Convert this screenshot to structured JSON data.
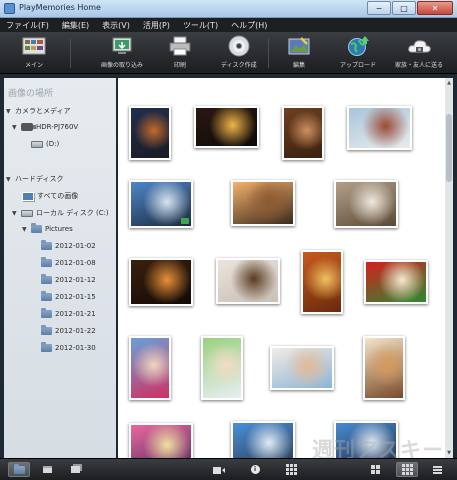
{
  "window": {
    "title": "PlayMemories Home",
    "minimize_glyph": "−",
    "maximize_glyph": "□",
    "close_glyph": "✕"
  },
  "menubar": [
    "ファイル(F)",
    "編集(E)",
    "表示(V)",
    "活用(P)",
    "ツール(T)",
    "ヘルプ(H)"
  ],
  "toolbar": {
    "main_label": "メイン",
    "import_label": "画像の取り込み",
    "print_label": "印刷",
    "disc_label": "ディスク作成",
    "edit_label": "編集",
    "upload_label": "アップロード",
    "share_label": "家族・友人に送る"
  },
  "sidebar": {
    "heading": "画像の場所",
    "camera_section": "カメラとメディア",
    "camera_device": "HDR-PJ760V",
    "camera_drive": "(D:)",
    "hdd_section": "ハードディスク",
    "all_images": "すべての画像",
    "local_disk": "ローカル ディスク (C:)",
    "pictures": "Pictures",
    "folders": [
      "2012-01-02",
      "2012-01-08",
      "2012-01-12",
      "2012-01-15",
      "2012-01-21",
      "2012-01-22",
      "2012-01-30"
    ]
  },
  "thumbnails": [
    {
      "name": "night-city",
      "colors": [
        "#20304f",
        "#c46a2a",
        "#1a1a25"
      ]
    },
    {
      "name": "fireworks-bridge",
      "colors": [
        "#2a1810",
        "#f0b64a",
        "#0e0a08"
      ]
    },
    {
      "name": "puppy",
      "colors": [
        "#6d4020",
        "#d09060",
        "#3a2010"
      ]
    },
    {
      "name": "brick-building",
      "colors": [
        "#a9c4da",
        "#9a4a35",
        "#e8ecef"
      ]
    },
    {
      "name": "rainbow-bridge",
      "colors": [
        "#4e86c8",
        "#d8e4ef",
        "#1c2a40"
      ]
    },
    {
      "name": "harbor-sunset",
      "colors": [
        "#f3b26a",
        "#8e5a32",
        "#3c2a1e"
      ]
    },
    {
      "name": "dog-in-snow",
      "colors": [
        "#b2a08a",
        "#efe9df",
        "#5c4a36"
      ]
    },
    {
      "name": "birthday-cake",
      "colors": [
        "#3a200e",
        "#e8903a",
        "#120a05"
      ]
    },
    {
      "name": "cake-slice",
      "colors": [
        "#e9e4dd",
        "#5a3a22",
        "#c9bfb5"
      ]
    },
    {
      "name": "autumn-leaves",
      "colors": [
        "#c85a1e",
        "#f0c060",
        "#6a2a0c"
      ]
    },
    {
      "name": "flowers",
      "colors": [
        "#d52020",
        "#f4e9d0",
        "#2a8a30"
      ]
    },
    {
      "name": "girl-with-toy",
      "colors": [
        "#6aa0d8",
        "#f0d6bf",
        "#d03060"
      ]
    },
    {
      "name": "toddler-park",
      "colors": [
        "#9ad080",
        "#f2dcc4",
        "#e8eef2"
      ]
    },
    {
      "name": "baby-portrait",
      "colors": [
        "#f2ece6",
        "#e2b996",
        "#8ab4d8"
      ]
    },
    {
      "name": "child-backlit",
      "colors": [
        "#f4e4c8",
        "#d89a5a",
        "#7a4a2a"
      ]
    },
    {
      "name": "festival-stalls",
      "colors": [
        "#e86aa0",
        "#f0e0a0",
        "#5a2a60"
      ]
    },
    {
      "name": "stadium-sky",
      "colors": [
        "#4a90d8",
        "#e0ecf6",
        "#2a3a50"
      ]
    },
    {
      "name": "ship-blue-sky",
      "colors": [
        "#4a8ad0",
        "#dfe9f2",
        "#1e2e48"
      ]
    }
  ],
  "watermark": "週刊アスキー"
}
